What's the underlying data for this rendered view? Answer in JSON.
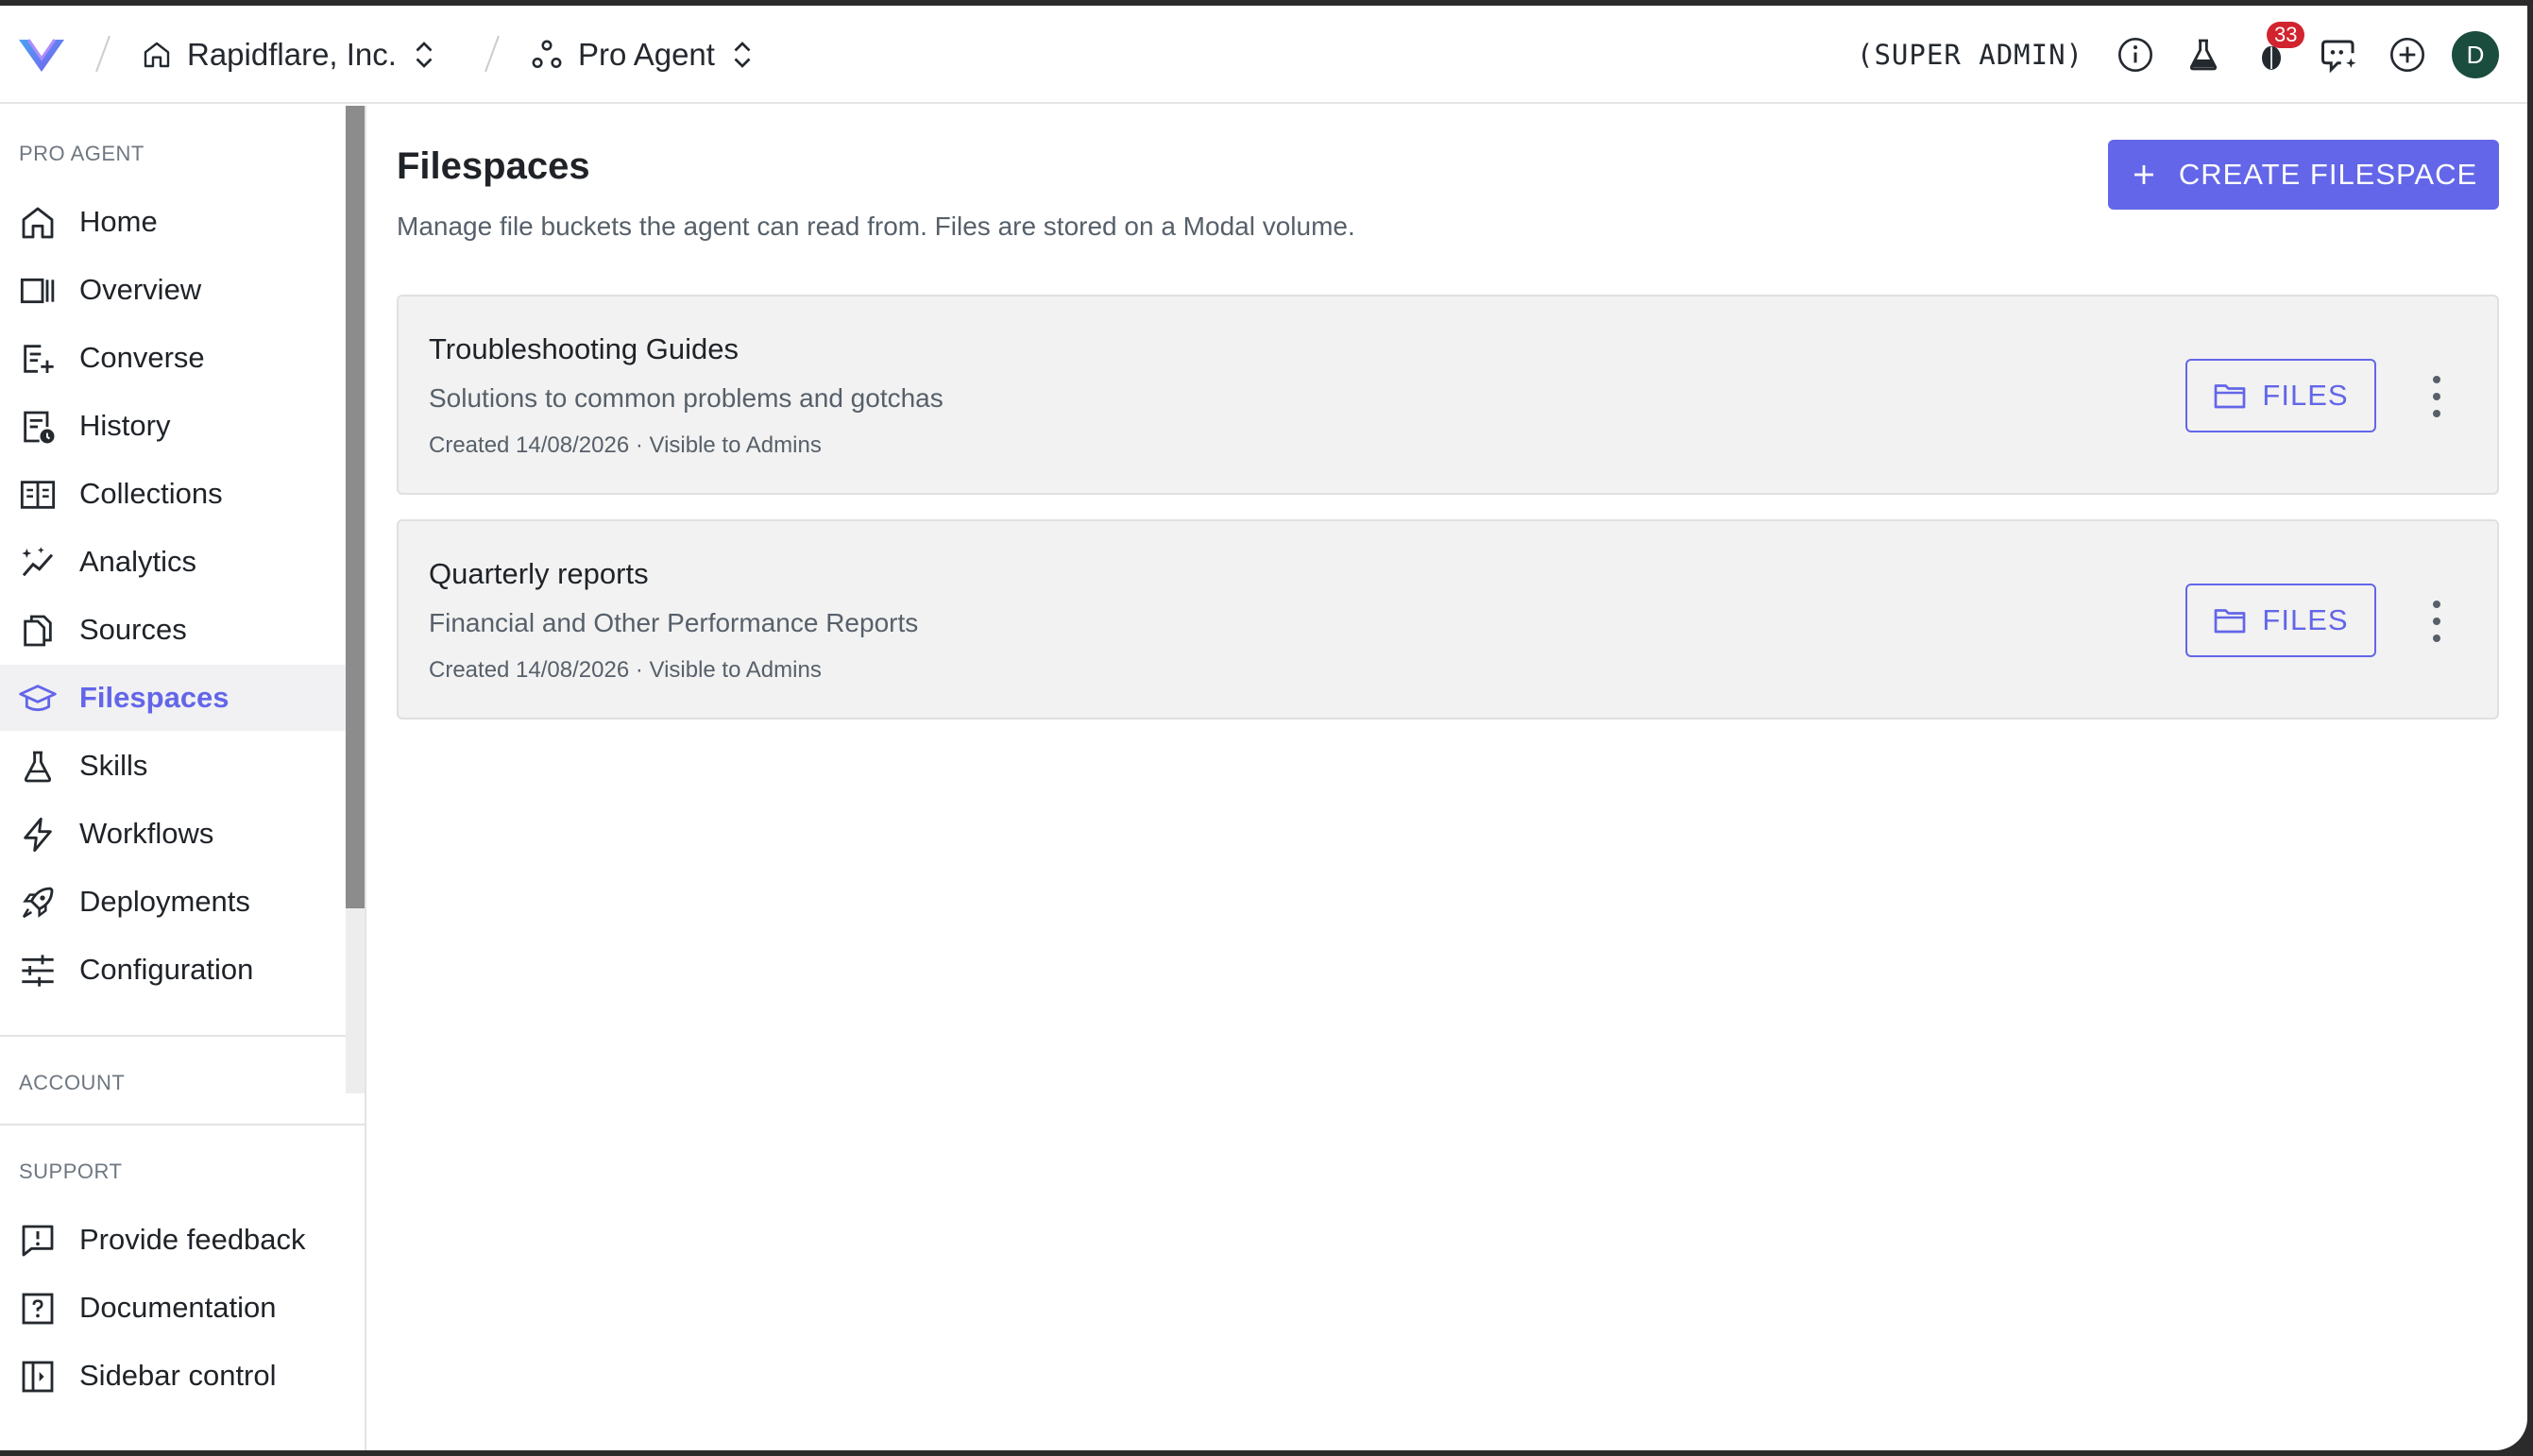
{
  "topbar": {
    "org_name": "Rapidflare, Inc.",
    "agent_name": "Pro Agent",
    "role": "(SUPER ADMIN)",
    "notification_count": "33",
    "avatar_initial": "D"
  },
  "sidebar": {
    "section_pro_agent": "PRO AGENT",
    "items": [
      {
        "label": "Home",
        "icon": "home-icon"
      },
      {
        "label": "Overview",
        "icon": "layout-columns-icon"
      },
      {
        "label": "Converse",
        "icon": "chat-add-icon"
      },
      {
        "label": "History",
        "icon": "history-icon"
      },
      {
        "label": "Collections",
        "icon": "collections-icon"
      },
      {
        "label": "Analytics",
        "icon": "analytics-sparkle-icon"
      },
      {
        "label": "Sources",
        "icon": "documents-icon"
      },
      {
        "label": "Filespaces",
        "icon": "graduation-cap-icon",
        "active": true
      },
      {
        "label": "Skills",
        "icon": "flask-icon"
      },
      {
        "label": "Workflows",
        "icon": "lightning-icon"
      },
      {
        "label": "Deployments",
        "icon": "rocket-icon"
      },
      {
        "label": "Configuration",
        "icon": "sliders-icon"
      }
    ],
    "section_account": "ACCOUNT",
    "section_support": "SUPPORT",
    "support_items": [
      {
        "label": "Provide feedback",
        "icon": "feedback-icon"
      },
      {
        "label": "Documentation",
        "icon": "help-icon"
      },
      {
        "label": "Sidebar control",
        "icon": "sidebar-toggle-icon"
      }
    ]
  },
  "main": {
    "title": "Filespaces",
    "subtitle": "Manage file buckets the agent can read from. Files are stored on a Modal volume.",
    "create_label": "CREATE FILESPACE",
    "files_label": "FILES",
    "filespaces": [
      {
        "name": "Troubleshooting Guides",
        "description": "Solutions to common problems and gotchas",
        "meta": "Created 14/08/2026 · Visible to Admins"
      },
      {
        "name": "Quarterly reports",
        "description": "Financial and Other Performance Reports",
        "meta": "Created 14/08/2026 · Visible to Admins"
      }
    ]
  },
  "colors": {
    "accent": "#6366e8",
    "badge": "#d1242f",
    "avatar": "#1b4d3e"
  }
}
